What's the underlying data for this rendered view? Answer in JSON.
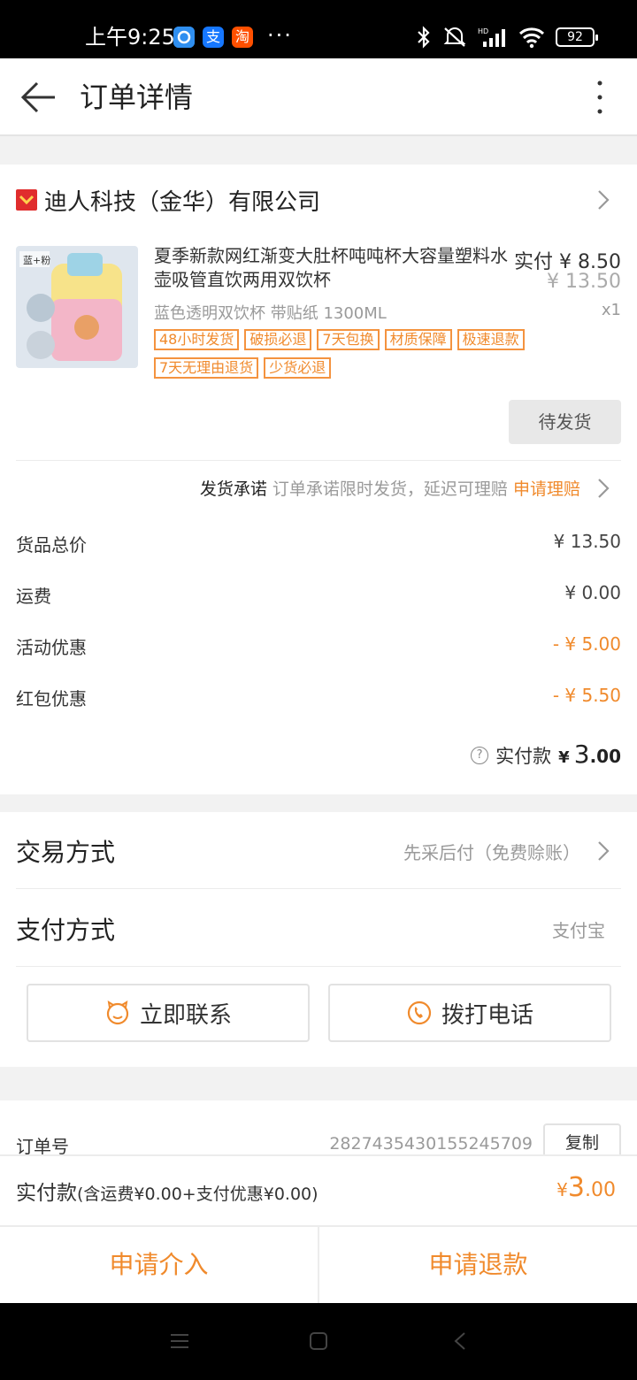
{
  "status_bar": {
    "time": "上午9:25",
    "apps": [
      "支",
      "淘"
    ],
    "more": "···",
    "battery": "92"
  },
  "header": {
    "title": "订单详情"
  },
  "shop": {
    "name": "迪人科技（金华）有限公司"
  },
  "product": {
    "title": "夏季新款网红渐变大肚杯吨吨杯大容量塑料水壶吸管直饮两用双饮杯",
    "price_label": "实付",
    "price": "¥ 8.50",
    "original_price": "¥ 13.50",
    "sku": "蓝色透明双饮杯 带贴纸 1300ML",
    "qty": "x1",
    "image_text": "蓝+粉",
    "tags": [
      "48小时发货",
      "破损必退",
      "7天包换",
      "材质保障",
      "极速退款",
      "7天无理由退货",
      "少货必退"
    ],
    "status": "待发货"
  },
  "promise": {
    "label": "发货承诺",
    "desc": "订单承诺限时发货，延迟可理赔",
    "link": "申请理赔"
  },
  "costs": [
    {
      "label": "货品总价",
      "value": "¥ 13.50"
    },
    {
      "label": "运费",
      "value": "¥ 0.00"
    },
    {
      "label": "活动优惠",
      "value": "- ¥ 5.00"
    },
    {
      "label": "红包优惠",
      "value": "- ¥ 5.50"
    }
  ],
  "paid": {
    "label": "实付款",
    "yen": "¥",
    "int": "3",
    "dec": ".00"
  },
  "trade": {
    "label": "交易方式",
    "value": "先采后付（免费赊账）"
  },
  "payment": {
    "label": "支付方式",
    "value": "支付宝"
  },
  "actions": {
    "contact": "立即联系",
    "call": "拨打电话"
  },
  "order": {
    "label": "订单号",
    "number": "2827435430155245709",
    "copy": "复制"
  },
  "total_bar": {
    "label": "实付款",
    "detail": "(含运费¥0.00+支付优惠¥0.00)",
    "yen": "¥",
    "int": "3",
    "dec": ".00"
  },
  "bottom": {
    "intervene": "申请介入",
    "refund": "申请退款"
  },
  "colors": {
    "accent": "#f08a2c",
    "muted": "#9a9a9a",
    "background": "#f2f2f2"
  }
}
